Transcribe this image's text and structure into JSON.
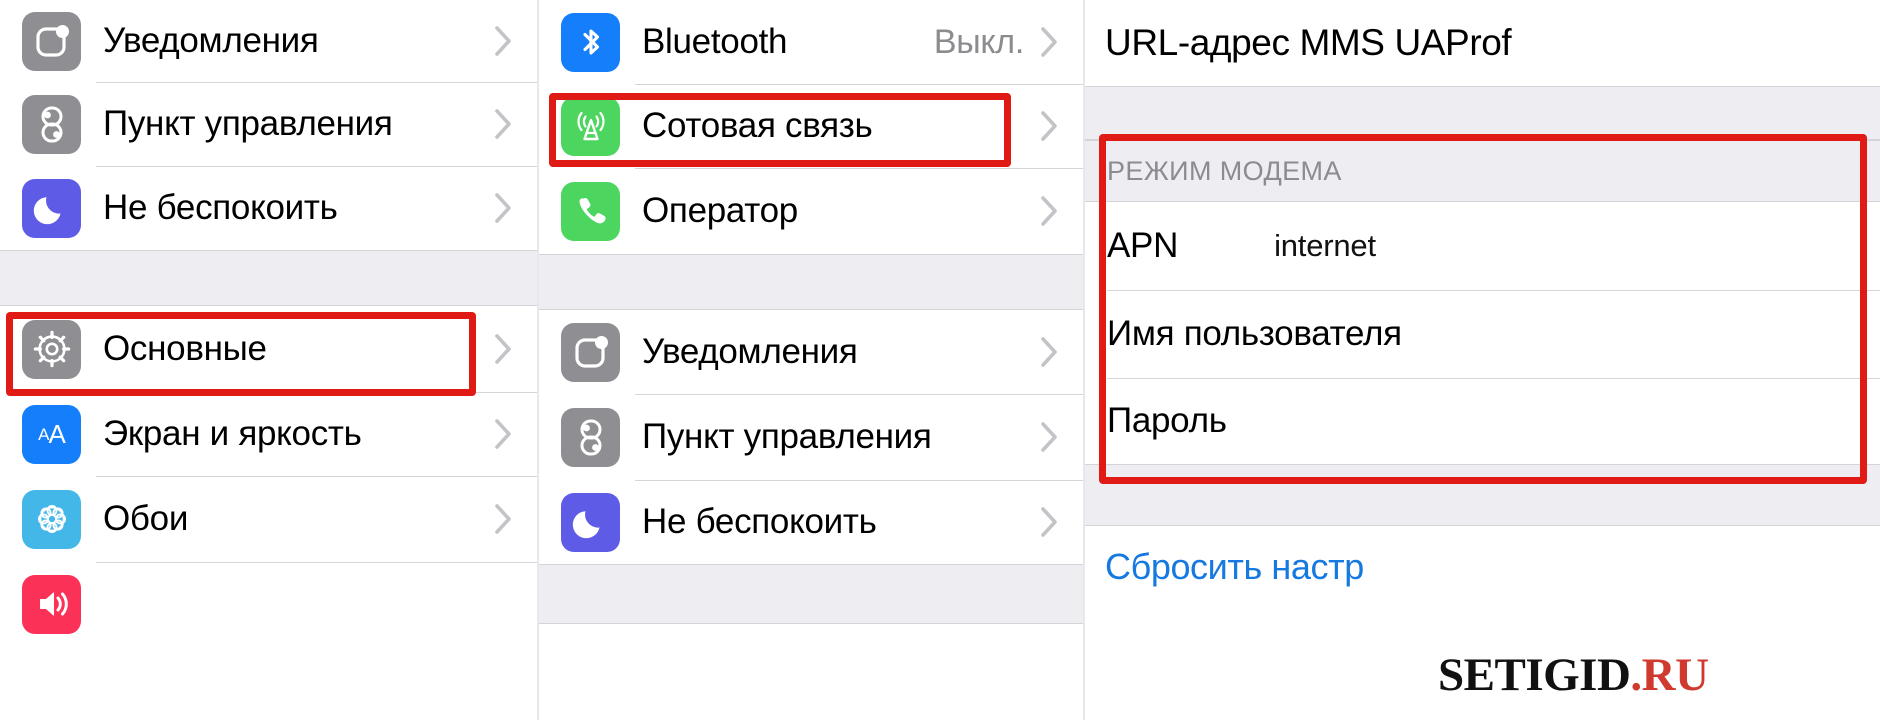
{
  "left_panel": {
    "group_top": [
      {
        "label": "Уведомления",
        "icon": "notifications-icon",
        "chevron": true
      },
      {
        "label": "Пункт управления",
        "icon": "control-center-icon",
        "chevron": true
      },
      {
        "label": "Не беспокоить",
        "icon": "do-not-disturb-icon",
        "chevron": true
      }
    ],
    "group_bottom": [
      {
        "label": "Основные",
        "icon": "general-gear-icon",
        "chevron": true,
        "highlighted": true
      },
      {
        "label": "Экран и яркость",
        "icon": "display-brightness-icon",
        "chevron": true
      },
      {
        "label": "Обои",
        "icon": "wallpaper-icon",
        "chevron": true
      },
      {
        "label": "",
        "icon": "sounds-icon",
        "chevron": false
      }
    ]
  },
  "middle_panel": {
    "group_top": [
      {
        "label": "Bluetooth",
        "value": "Выкл.",
        "icon": "bluetooth-icon",
        "chevron": true
      },
      {
        "label": "Сотовая связь",
        "value": "",
        "icon": "cellular-icon",
        "chevron": true,
        "highlighted": true
      },
      {
        "label": "Оператор",
        "value": "",
        "icon": "carrier-phone-icon",
        "chevron": true
      }
    ],
    "group_bottom": [
      {
        "label": "Уведомления",
        "icon": "notifications-icon",
        "chevron": true
      },
      {
        "label": "Пункт управления",
        "icon": "control-center-icon",
        "chevron": true
      },
      {
        "label": "Не беспокоить",
        "icon": "do-not-disturb-icon",
        "chevron": true
      }
    ]
  },
  "right_panel": {
    "title": "URL-адрес MMS UAProf",
    "section_caption": "РЕЖИМ МОДЕМА",
    "fields": [
      {
        "label": "APN",
        "value": "internet"
      },
      {
        "label": "Имя пользователя",
        "value": ""
      },
      {
        "label": "Пароль",
        "value": ""
      }
    ],
    "reset_link": "Сбросить настр"
  },
  "watermark": {
    "part_name": "SETIGID",
    "part_tld": ".RU"
  },
  "colors": {
    "highlight_red": "#e01b16",
    "link_blue": "#1579e0",
    "group_grey": "#eeeef2",
    "value_grey": "#8c8c90"
  }
}
